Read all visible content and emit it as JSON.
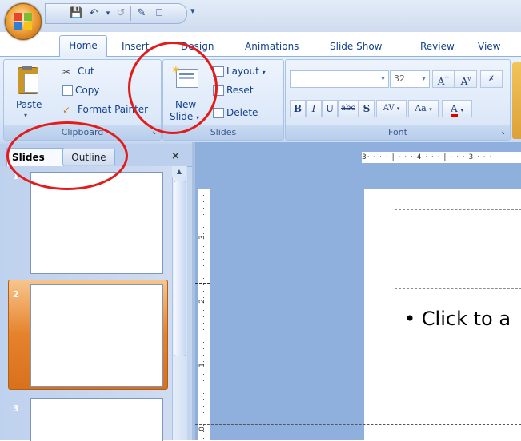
{
  "ribbon_tabs": [
    "Home",
    "Insert",
    "Design",
    "Animations",
    "Slide Show",
    "Review",
    "View"
  ],
  "clipboard": {
    "paste": "Paste",
    "cut": "Cut",
    "copy": "Copy",
    "format_painter": "Format Painter",
    "label": "Clipboard"
  },
  "slides_group": {
    "new_slide_line1": "New",
    "new_slide_line2": "Slide",
    "layout": "Layout",
    "reset": "Reset",
    "delete": "Delete",
    "label": "Slides"
  },
  "font_group": {
    "size": "32",
    "label": "Font",
    "bold": "B",
    "italic": "I",
    "underline": "U",
    "strike": "abc",
    "shadow": "S",
    "spacing": "AV",
    "case": "Aa",
    "color": "A"
  },
  "pane_tabs": {
    "slides": "Slides",
    "outline": "Outline"
  },
  "thumbnails": [
    "1",
    "2",
    "3"
  ],
  "ruler": {
    "h": "3· · · · | · · · 4 · · · | · · · 3 · · ·",
    "v": [
      "3",
      "2",
      "1",
      "0"
    ]
  },
  "slide": {
    "body_text": "• Click to a"
  },
  "colors": {
    "accent_red": "#e21b1b",
    "selected_thumb": "#e5822b",
    "ribbon_blue": "#dbe7f7"
  }
}
